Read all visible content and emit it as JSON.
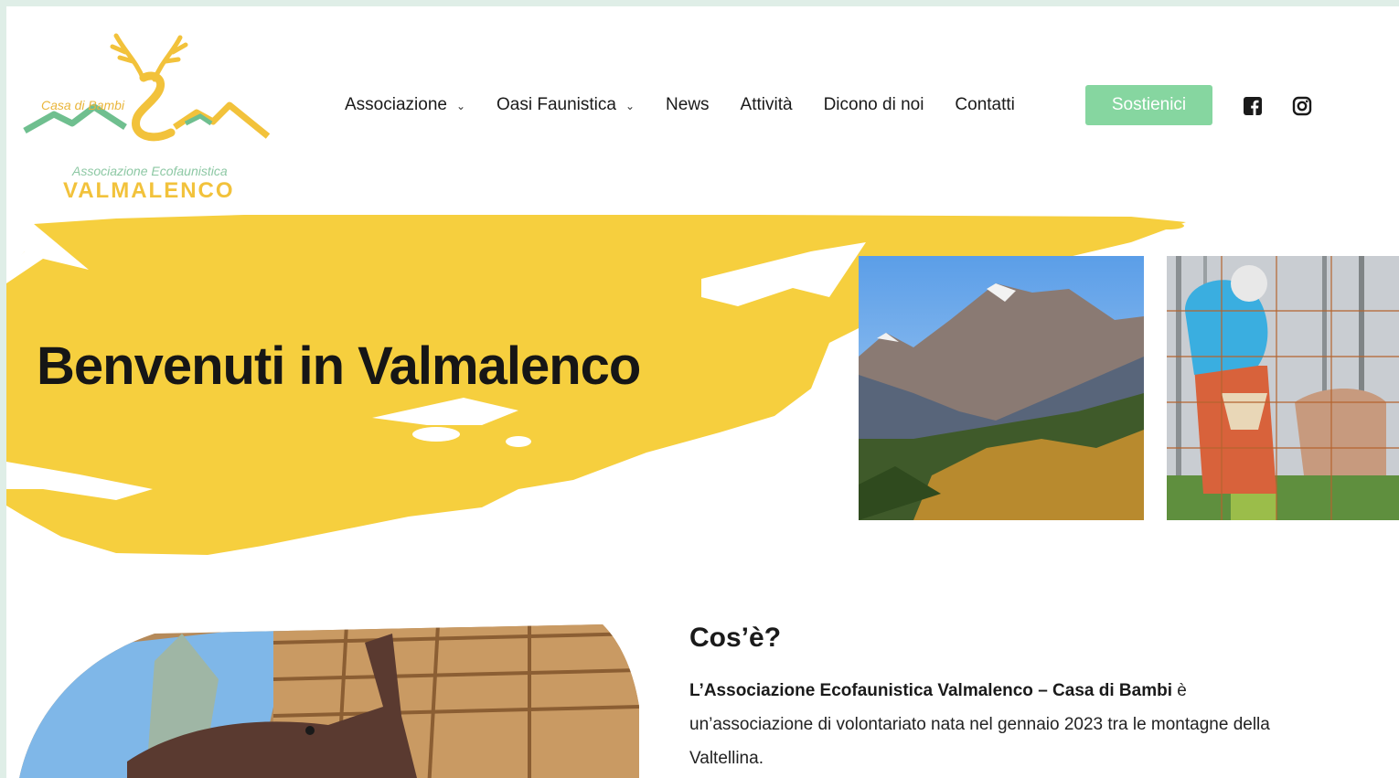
{
  "logo": {
    "top_text": "Casa di Bambi",
    "middle_text": "Associazione Ecofaunistica",
    "bottom_text": "VALMALENCO"
  },
  "nav": {
    "items": [
      {
        "label": "Associazione",
        "has_dropdown": true
      },
      {
        "label": "Oasi Faunistica",
        "has_dropdown": true
      },
      {
        "label": "News",
        "has_dropdown": false
      },
      {
        "label": "Attività",
        "has_dropdown": false
      },
      {
        "label": "Dicono di noi",
        "has_dropdown": false
      },
      {
        "label": "Contatti",
        "has_dropdown": false
      }
    ],
    "cta_label": "Sostienici",
    "social": [
      "facebook-icon",
      "instagram-icon"
    ]
  },
  "hero": {
    "title": "Benvenuti in Valmalenco"
  },
  "intro": {
    "heading": "Cos’è?",
    "paragraph_bold": "L’Associazione Ecofaunistica Valmalenco – Casa di Bambi",
    "paragraph_rest": " è un’associazione di volontariato nata nel gennaio 2023 tra le montagne della Valtellina."
  },
  "colors": {
    "accent_yellow": "#f6cf3e",
    "cta_green": "#86d6a0",
    "logo_green": "#6fbf8f",
    "logo_gold": "#f2c23b"
  }
}
